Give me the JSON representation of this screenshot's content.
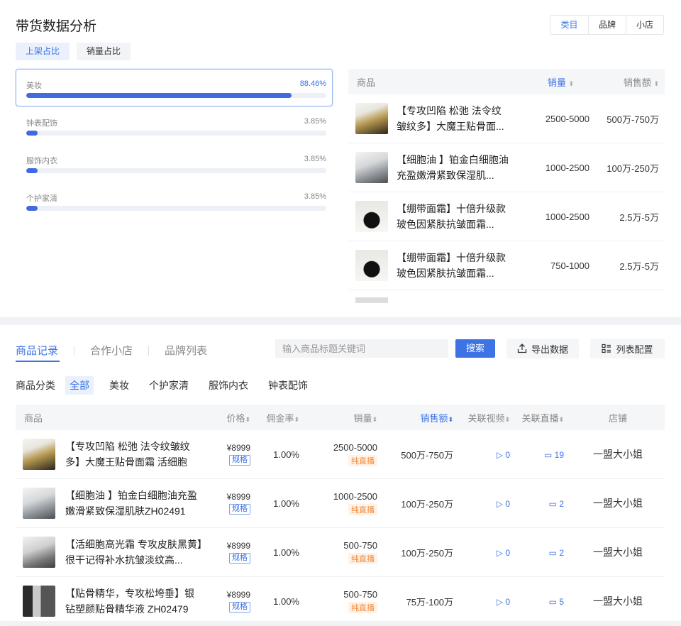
{
  "top": {
    "title": "带货数据分析",
    "seg": [
      "类目",
      "品牌",
      "小店"
    ],
    "ratio_tabs": [
      "上架占比",
      "销量占比"
    ],
    "categories": [
      {
        "name": "美妆",
        "pct": "88.46%",
        "ratio": 0.8846
      },
      {
        "name": "钟表配饰",
        "pct": "3.85%",
        "ratio": 0.0385
      },
      {
        "name": "服饰内衣",
        "pct": "3.85%",
        "ratio": 0.0385
      },
      {
        "name": "个护家清",
        "pct": "3.85%",
        "ratio": 0.0385
      }
    ],
    "table": {
      "headers": {
        "product": "商品",
        "sales": "销量",
        "revenue": "销售额"
      },
      "rows": [
        {
          "title": "【专攻凹陷 松弛 法令纹皱纹多】大魔王贴骨面...",
          "sales": "2500-5000",
          "revenue": "500万-750万"
        },
        {
          "title": "【细胞油 】铂金白细胞油充盈嫩滑紧致保湿肌...",
          "sales": "1000-2500",
          "revenue": "100万-250万"
        },
        {
          "title": "【绷带面霜】十倍升级款玻色因紧肤抗皱面霜...",
          "sales": "1000-2500",
          "revenue": "2.5万-5万"
        },
        {
          "title": "【绷带面霜】十倍升级款玻色因紧肤抗皱面霜...",
          "sales": "750-1000",
          "revenue": "2.5万-5万"
        }
      ]
    }
  },
  "bottom": {
    "tabs": [
      "商品记录",
      "合作小店",
      "品牌列表"
    ],
    "search_placeholder": "输入商品标题关键词",
    "search_btn": "搜索",
    "export_btn": "导出数据",
    "config_btn": "列表配置",
    "filter_label": "商品分类",
    "filters": [
      "全部",
      "美妆",
      "个护家清",
      "服饰内衣",
      "钟表配饰"
    ],
    "headers": {
      "product": "商品",
      "price": "价格",
      "commission": "佣金率",
      "sales": "销量",
      "revenue": "销售额",
      "video": "关联视频",
      "live": "关联直播",
      "shop": "店铺"
    },
    "spec_label": "规格",
    "rows": [
      {
        "title": "【专攻凹陷 松弛 法令纹皱纹多】大魔王贴骨面霜 活细胞科...",
        "price": "¥8999",
        "commission": "1.00%",
        "sales": "2500-5000",
        "tag": "纯直播",
        "revenue": "500万-750万",
        "video": "0",
        "live": "19",
        "shop": "一盟大小姐"
      },
      {
        "title": "【细胞油 】铂金白细胞油充盈嫩滑紧致保湿肌肤ZH02491",
        "price": "¥8999",
        "commission": "1.00%",
        "sales": "1000-2500",
        "tag": "纯直播",
        "revenue": "100万-250万",
        "video": "0",
        "live": "2",
        "shop": "一盟大小姐"
      },
      {
        "title": "【活细胞高光霜 专攻皮肤黑黄】很干记得补水抗皱淡纹高...",
        "price": "¥8999",
        "commission": "1.00%",
        "sales": "500-750",
        "tag": "纯直播",
        "revenue": "100万-250万",
        "video": "0",
        "live": "2",
        "shop": "一盟大小姐"
      },
      {
        "title": "【贴骨精华，专攻松垮垂】银钻塑颜贴骨精华液 ZH02479",
        "price": "¥8999",
        "commission": "1.00%",
        "sales": "500-750",
        "tag": "纯直播",
        "revenue": "75万-100万",
        "video": "0",
        "live": "5",
        "shop": "一盟大小姐"
      }
    ]
  },
  "colors": {
    "accent": "#3d73e4",
    "bar": "#4169e1",
    "live_tag": "#f08a3c"
  }
}
